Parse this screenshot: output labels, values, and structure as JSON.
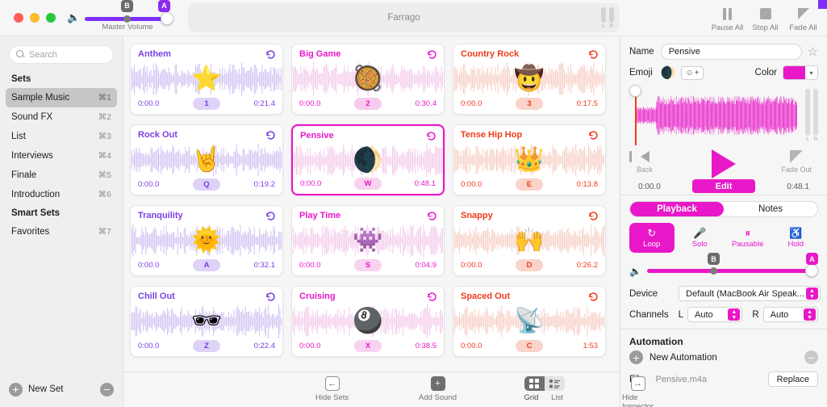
{
  "window": {
    "app_title": "Farrago",
    "traffic_lights": [
      "close",
      "minimize",
      "zoom"
    ]
  },
  "master_volume": {
    "label": "Master Volume",
    "badge_b": "B",
    "badge_a": "A",
    "track_color": "#7b2ff7"
  },
  "toolbar_right": [
    {
      "name": "pause-all",
      "label": "Pause All",
      "icon": "pause-icon"
    },
    {
      "name": "stop-all",
      "label": "Stop All",
      "icon": "stop-icon"
    },
    {
      "name": "fade-all",
      "label": "Fade All",
      "icon": "fade-icon"
    }
  ],
  "sidebar": {
    "search_placeholder": "Search",
    "search_value": "",
    "sets_header": "Sets",
    "sets": [
      {
        "label": "Sample Music",
        "shortcut": "⌘1",
        "selected": true
      },
      {
        "label": "Sound FX",
        "shortcut": "⌘2",
        "selected": false
      },
      {
        "label": "List",
        "shortcut": "⌘3",
        "selected": false
      },
      {
        "label": "Interviews",
        "shortcut": "⌘4",
        "selected": false
      },
      {
        "label": "Finale",
        "shortcut": "⌘5",
        "selected": false
      },
      {
        "label": "Introduction",
        "shortcut": "⌘6",
        "selected": false
      }
    ],
    "smart_sets_header": "Smart Sets",
    "smart_sets": [
      {
        "label": "Favorites",
        "shortcut": "⌘7",
        "selected": false
      }
    ],
    "new_set_label": "New Set",
    "add_icon": "plus-circle-icon",
    "remove_icon": "minus-circle-icon"
  },
  "tiles": [
    {
      "title": "Anthem",
      "emoji": "⭐",
      "key": "1",
      "start": "0:00.0",
      "end": "0:21.4",
      "color": "#7b3fe4",
      "wave": "#cfc0f2",
      "chip_bg": "#ded2f7",
      "selected": false
    },
    {
      "title": "Big Game",
      "emoji": "🥘",
      "key": "2",
      "start": "0:00.0",
      "end": "0:30.4",
      "color": "#e818c8",
      "wave": "#f3c9ea",
      "chip_bg": "#f7cbee",
      "selected": false
    },
    {
      "title": "Country Rock",
      "emoji": "🤠",
      "key": "3",
      "start": "0:00.0",
      "end": "0:17.5",
      "color": "#f03b1c",
      "wave": "#f6cdc2",
      "chip_bg": "#fad3c9",
      "selected": false
    },
    {
      "title": "Rock Out",
      "emoji": "🤘",
      "key": "Q",
      "start": "0:00.0",
      "end": "0:19.2",
      "color": "#7b3fe4",
      "wave": "#cfc0f2",
      "chip_bg": "#ded2f7",
      "selected": false
    },
    {
      "title": "Pensive",
      "emoji": "🌒",
      "key": "W",
      "start": "0:00.0",
      "end": "0:48.1",
      "color": "#e818c8",
      "wave": "#f3c9ea",
      "chip_bg": "#f9d2f0",
      "selected": true
    },
    {
      "title": "Tense Hip Hop",
      "emoji": "👑",
      "key": "E",
      "start": "0:00.0",
      "end": "0:13.8",
      "color": "#f03b1c",
      "wave": "#f6cdc2",
      "chip_bg": "#fad3c9",
      "selected": false
    },
    {
      "title": "Tranquility",
      "emoji": "🌞",
      "key": "A",
      "start": "0:00.0",
      "end": "0:32.1",
      "color": "#7b3fe4",
      "wave": "#cfc0f2",
      "chip_bg": "#ded2f7",
      "selected": false
    },
    {
      "title": "Play Time",
      "emoji": "👾",
      "key": "S",
      "start": "0:00.0",
      "end": "0:04.9",
      "color": "#e818c8",
      "wave": "#f3c9ea",
      "chip_bg": "#f9d2f0",
      "selected": false
    },
    {
      "title": "Snappy",
      "emoji": "🙌",
      "key": "D",
      "start": "0:00.0",
      "end": "0:26.2",
      "color": "#f03b1c",
      "wave": "#f6cdc2",
      "chip_bg": "#fad3c9",
      "selected": false
    },
    {
      "title": "Chill Out",
      "emoji": "🕶",
      "key": "Z",
      "start": "0:00.0",
      "end": "0:22.4",
      "color": "#7b3fe4",
      "wave": "#cfc0f2",
      "chip_bg": "#ded2f7",
      "selected": false
    },
    {
      "title": "Cruising",
      "emoji": "🎱",
      "key": "X",
      "start": "0:00.0",
      "end": "0:38.5",
      "color": "#e818c8",
      "wave": "#f3c9ea",
      "chip_bg": "#f9d2f0",
      "selected": false
    },
    {
      "title": "Spaced Out",
      "emoji": "📡",
      "key": "C",
      "start": "0:00.0",
      "end": "1:53",
      "color": "#f03b1c",
      "wave": "#f6cdc2",
      "chip_bg": "#fad3c9",
      "selected": false
    }
  ],
  "bottom_toolbar": {
    "hide_sets": "Hide Sets",
    "add_sound": "Add Sound",
    "grid": "Grid",
    "list": "List",
    "hide_inspector": "Hide Inspector",
    "view_mode": "Grid"
  },
  "inspector": {
    "name_label": "Name",
    "name_value": "Pensive",
    "favorite_icon": "star-outline-icon",
    "emoji_label": "Emoji",
    "emoji_value": "🌒",
    "emoji_add_label": "+",
    "color_label": "Color",
    "color_value": "#e818c8",
    "meters": {
      "left": "L",
      "right": "R"
    },
    "transport": {
      "back_label": "Back",
      "fade_out_label": "Fade Out",
      "edit_label": "Edit",
      "start_time": "0:00.0",
      "end_time": "0:48.1"
    },
    "tabs": [
      {
        "label": "Playback",
        "active": true
      },
      {
        "label": "Notes",
        "active": false
      }
    ],
    "modes": [
      {
        "label": "Loop",
        "icon": "loop-icon",
        "on": true
      },
      {
        "label": "Solo",
        "icon": "solo-icon",
        "on": false
      },
      {
        "label": "Pausable",
        "icon": "pausable-icon",
        "on": false
      },
      {
        "label": "Hold",
        "icon": "hold-icon",
        "on": false
      }
    ],
    "volume": {
      "badge_b": "B",
      "badge_a": "A"
    },
    "device_label": "Device",
    "device_value": "Default (MacBook Air Speak...",
    "channels_label": "Channels",
    "channel_left_label": "L",
    "channel_left_value": "Auto",
    "channel_right_label": "R",
    "channel_right_value": "Auto",
    "automation_header": "Automation",
    "new_automation_label": "New Automation",
    "file_label": "File",
    "file_value": "Pensive.m4a",
    "replace_label": "Replace"
  }
}
